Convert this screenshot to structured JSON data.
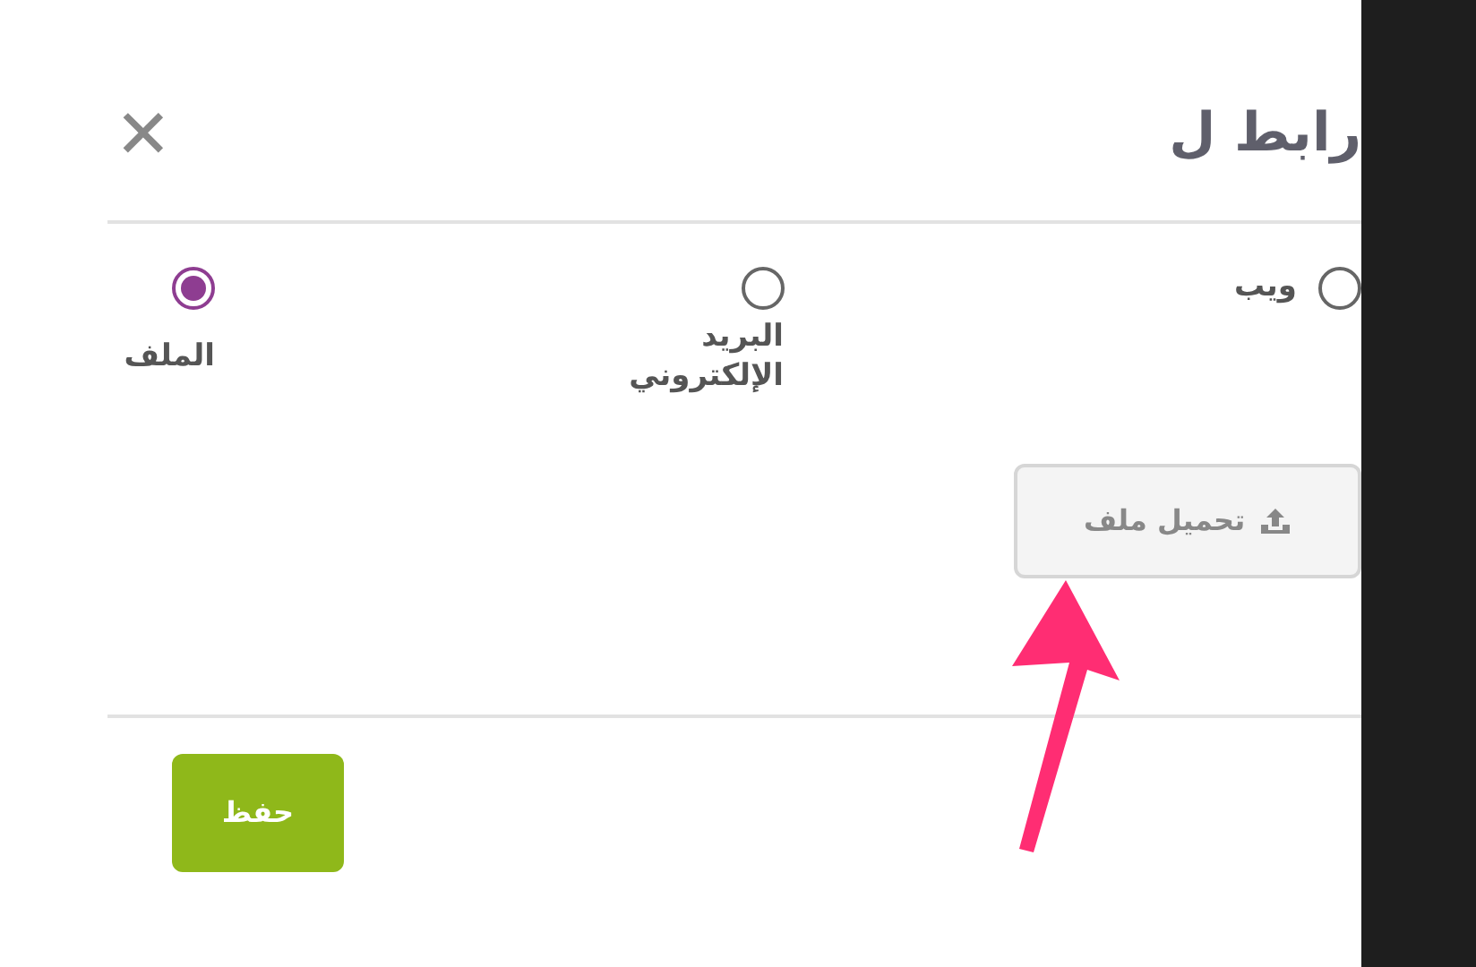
{
  "dialog": {
    "title": "رابط ل",
    "close": "✕"
  },
  "link_types": [
    {
      "label": "ويب",
      "selected": false
    },
    {
      "label": "البريد الإلكتروني",
      "selected": false
    },
    {
      "label": "الملف",
      "selected": true
    }
  ],
  "upload_button": "تحميل ملف",
  "save_button": "حفظ"
}
